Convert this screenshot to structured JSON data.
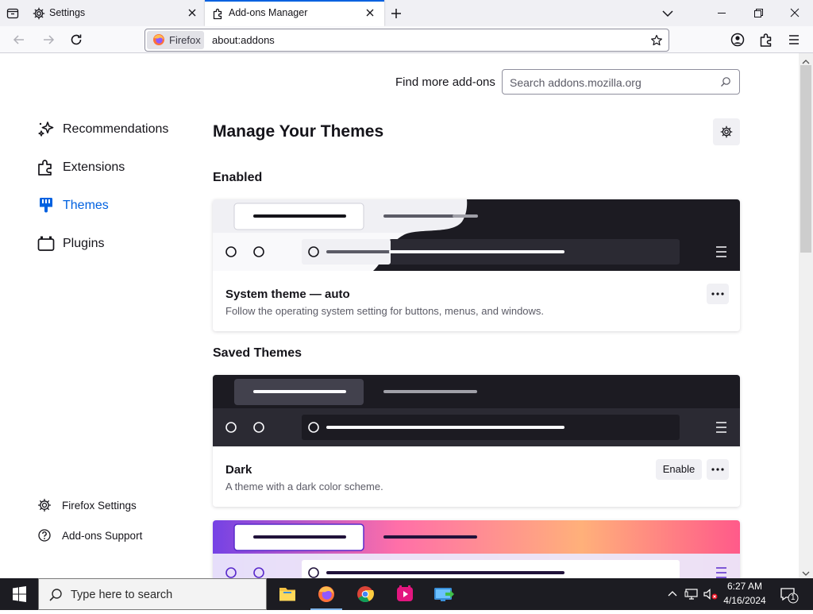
{
  "tabs": [
    {
      "label": "Settings"
    },
    {
      "label": "Add-ons Manager"
    }
  ],
  "urlbar": {
    "identity_label": "Firefox",
    "url": "about:addons"
  },
  "sidebar": {
    "items": [
      {
        "label": "Recommendations"
      },
      {
        "label": "Extensions"
      },
      {
        "label": "Themes"
      },
      {
        "label": "Plugins"
      }
    ],
    "footer": [
      {
        "label": "Firefox Settings"
      },
      {
        "label": "Add-ons Support"
      }
    ]
  },
  "main": {
    "find_more_label": "Find more add-ons",
    "search_placeholder": "Search addons.mozilla.org",
    "title": "Manage Your Themes",
    "enabled_heading": "Enabled",
    "saved_heading": "Saved Themes",
    "themes": [
      {
        "name": "System theme — auto",
        "description": "Follow the operating system setting for buttons, menus, and windows."
      },
      {
        "name": "Dark",
        "description": "A theme with a dark color scheme.",
        "action_label": "Enable"
      }
    ]
  },
  "taskbar": {
    "search_placeholder": "Type here to search",
    "time": "6:27 AM",
    "date": "4/16/2024",
    "notification_count": "1"
  },
  "colors": {
    "accent": "#0061e0",
    "dark_theme_bg": "#1c1b22",
    "light_theme_bg": "#f0f0f4",
    "taskbar": "#1c1c22"
  }
}
